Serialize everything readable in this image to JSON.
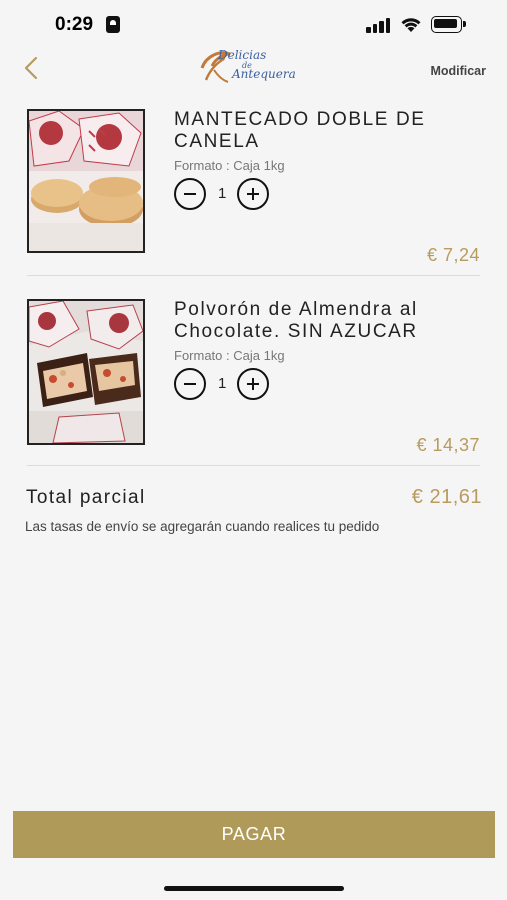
{
  "status_bar": {
    "time": "0:29"
  },
  "nav": {
    "logo_line1": "Delicias",
    "logo_de": "de",
    "logo_line2": "Antequera",
    "modify_label": "Modificar"
  },
  "products": [
    {
      "name": "MANTECADO DOBLE DE CANELA",
      "format": "Formato : Caja 1kg",
      "quantity": "1",
      "price": "€ 7,24"
    },
    {
      "name": "Polvorón de Almendra al Chocolate. SIN AZUCAR",
      "format": "Formato : Caja 1kg",
      "quantity": "1",
      "price": "€ 14,37"
    }
  ],
  "summary": {
    "subtotal_label": "Total parcial",
    "subtotal_value": "€ 21,61",
    "shipping_note": "Las tasas de envío se agregarán cuando realices tu pedido"
  },
  "checkout": {
    "pay_label": "PAGAR"
  },
  "colors": {
    "accent": "#b89b5e",
    "button": "#b09a5a",
    "background": "#f5f5f5"
  }
}
